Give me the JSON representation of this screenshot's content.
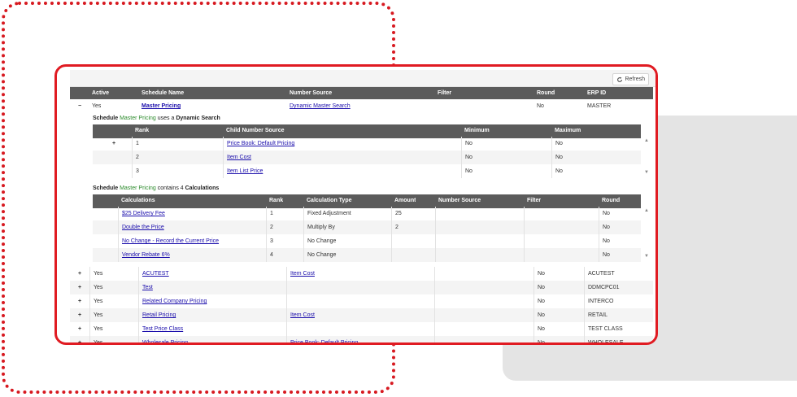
{
  "refresh_label": "Refresh",
  "main_headers": [
    "Active",
    "Schedule Name",
    "Number Source",
    "Filter",
    "Round",
    "ERP ID"
  ],
  "expanded_row": {
    "toggle": "−",
    "active": "Yes",
    "name": "Master Pricing",
    "number_source": "Dynamic Master Search",
    "filter": "",
    "round": "No",
    "erp_id": "MASTER"
  },
  "dynamic_section": {
    "prefix": "Schedule ",
    "schedule": "Master Pricing",
    "middle": " uses a ",
    "kind": "Dynamic Search",
    "headers": [
      "Rank",
      "Child Number Source",
      "Minimum",
      "Maximum"
    ],
    "rows": [
      {
        "toggle": "+",
        "rank": "1",
        "source": "Price Book: Default Pricing",
        "min": "No",
        "max": "No"
      },
      {
        "toggle": "",
        "rank": "2",
        "source": "Item Cost",
        "min": "No",
        "max": "No"
      },
      {
        "toggle": "",
        "rank": "3",
        "source": "Item List Price",
        "min": "No",
        "max": "No"
      }
    ]
  },
  "calc_section": {
    "prefix": "Schedule ",
    "schedule": "Master Pricing",
    "middle": " contains 4 ",
    "kind": "Calculations",
    "headers": [
      "Calculations",
      "Rank",
      "Calculation Type",
      "Amount",
      "Number Source",
      "Filter",
      "Round"
    ],
    "rows": [
      {
        "name": "$25 Delivery Fee",
        "rank": "1",
        "type": "Fixed Adjustment",
        "amount": "25",
        "source": "",
        "filter": "",
        "round": "No"
      },
      {
        "name": "Double the Price",
        "rank": "2",
        "type": "Multiply By",
        "amount": "2",
        "source": "",
        "filter": "",
        "round": "No"
      },
      {
        "name": "No Change - Record the Current Price",
        "rank": "3",
        "type": "No Change",
        "amount": "",
        "source": "",
        "filter": "",
        "round": "No"
      },
      {
        "name": "Vendor Rebate 6%",
        "rank": "4",
        "type": "No Change",
        "amount": "",
        "source": "",
        "filter": "",
        "round": "No"
      }
    ]
  },
  "schedules": [
    {
      "toggle": "+",
      "active": "Yes",
      "name": "ACUTEST",
      "number_source": "Item Cost",
      "filter": "",
      "round": "No",
      "erp_id": "ACUTEST"
    },
    {
      "toggle": "+",
      "active": "Yes",
      "name": "Test",
      "number_source": "",
      "filter": "",
      "round": "No",
      "erp_id": "DDMCPC01"
    },
    {
      "toggle": "+",
      "active": "Yes",
      "name": "Related Company Pricing",
      "number_source": "",
      "filter": "",
      "round": "No",
      "erp_id": "INTERCO"
    },
    {
      "toggle": "+",
      "active": "Yes",
      "name": "Retail Pricing",
      "number_source": "Item Cost",
      "filter": "",
      "round": "No",
      "erp_id": "RETAIL"
    },
    {
      "toggle": "+",
      "active": "Yes",
      "name": "Test Price Class",
      "number_source": "",
      "filter": "",
      "round": "No",
      "erp_id": "TEST CLASS"
    },
    {
      "toggle": "+",
      "active": "Yes",
      "name": "Wholesale Pricing",
      "number_source": "Price Book: Default Pricing",
      "filter": "",
      "round": "No",
      "erp_id": "WHOLESALE"
    }
  ],
  "colors": {
    "frame": "#e01b22",
    "header": "#5b5b5b",
    "link": "#1a0dab",
    "schedule_name": "#2a8a2a"
  }
}
